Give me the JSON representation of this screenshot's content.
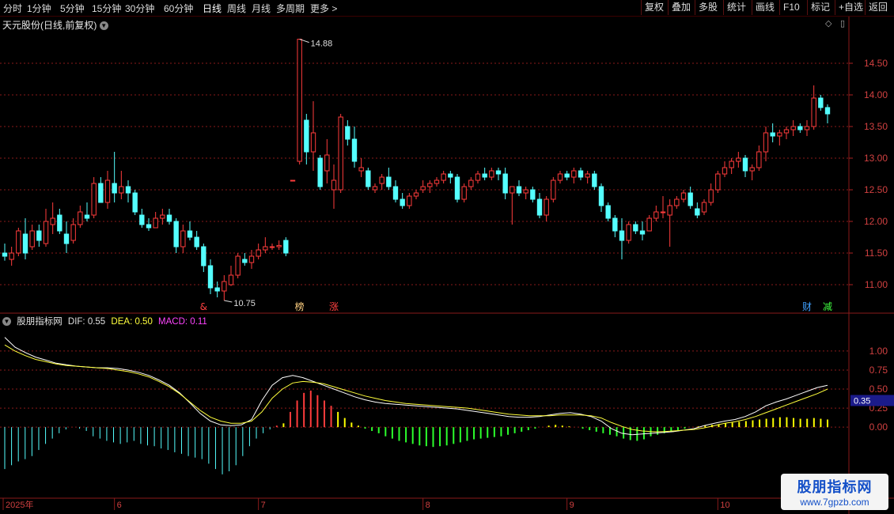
{
  "toolbar": {
    "timeframes": [
      "分时",
      "1分钟",
      "5分钟",
      "15分钟",
      "30分钟",
      "60分钟",
      "日线",
      "周线",
      "月线",
      "多周期",
      "更多 >"
    ],
    "active_timeframe": "日线",
    "buttons": [
      "复权",
      "叠加",
      "多股",
      "统计",
      "画线",
      "F10",
      "标记",
      "+自选",
      "返回"
    ]
  },
  "stock_title": "天元股份(日线,前复权)",
  "macd_header": {
    "name": "股朋指标网",
    "dif": "DIF: 0.55",
    "dea": "DEA: 0.50",
    "macd": "MACD: 0.11"
  },
  "watermark": {
    "line1": "股朋指标网",
    "line2": "www.7gpzb.com"
  },
  "colors": {
    "up": "#ff3c3c",
    "down": "#54ffff",
    "dif": "#ffffff",
    "dea": "#ffff3c",
    "macd_pos": "#ff3c3c",
    "macd_neg": "#54ffff",
    "bar_green": "#2cff2c",
    "bar_yellow": "#ffff00",
    "grid": "#8a1a1a",
    "macd_text": "#ff44ff"
  },
  "chart_data": [
    {
      "type": "candlestick",
      "title": "天元股份(日线,前复权)",
      "ylim": [
        10.6,
        15.0
      ],
      "yticks": [
        "11.00",
        "11.50",
        "12.00",
        "12.50",
        "13.00",
        "13.50",
        "14.00",
        "14.50"
      ],
      "xticks": [
        "2025年",
        "6",
        "7",
        "8",
        "9",
        "10",
        "11"
      ],
      "high_annotation": "14.88",
      "low_annotation": "10.75",
      "event_markers": [
        "&",
        "榜",
        "涨",
        "财",
        "减"
      ],
      "ohlc": [
        [
          11.5,
          11.65,
          11.38,
          11.45
        ],
        [
          11.4,
          11.6,
          11.3,
          11.5
        ],
        [
          11.5,
          11.9,
          11.45,
          11.85
        ],
        [
          11.8,
          12.05,
          11.4,
          11.5
        ],
        [
          11.6,
          11.95,
          11.55,
          11.85
        ],
        [
          11.85,
          11.95,
          11.6,
          11.7
        ],
        [
          11.65,
          12.2,
          11.6,
          12.0
        ],
        [
          11.95,
          12.3,
          11.8,
          12.05
        ],
        [
          12.1,
          12.2,
          11.8,
          11.85
        ],
        [
          11.8,
          12.0,
          11.5,
          11.65
        ],
        [
          11.7,
          12.05,
          11.65,
          11.95
        ],
        [
          11.95,
          12.25,
          11.9,
          12.15
        ],
        [
          12.1,
          12.3,
          12.0,
          12.05
        ],
        [
          12.1,
          12.7,
          12.05,
          12.6
        ],
        [
          12.6,
          12.7,
          12.3,
          12.3
        ],
        [
          12.3,
          12.8,
          12.2,
          12.65
        ],
        [
          12.6,
          13.1,
          12.3,
          12.45
        ],
        [
          12.45,
          12.8,
          12.35,
          12.55
        ],
        [
          12.55,
          12.65,
          12.3,
          12.45
        ],
        [
          12.45,
          12.5,
          12.1,
          12.15
        ],
        [
          12.1,
          12.2,
          11.9,
          11.95
        ],
        [
          11.95,
          12.05,
          11.85,
          11.9
        ],
        [
          11.9,
          12.15,
          11.9,
          12.05
        ],
        [
          12.05,
          12.2,
          11.95,
          12.1
        ],
        [
          12.1,
          12.2,
          11.95,
          12.0
        ],
        [
          12.0,
          12.05,
          11.5,
          11.6
        ],
        [
          11.6,
          11.95,
          11.5,
          11.85
        ],
        [
          11.85,
          12.0,
          11.7,
          11.75
        ],
        [
          11.75,
          11.85,
          11.55,
          11.6
        ],
        [
          11.6,
          11.65,
          11.2,
          11.3
        ],
        [
          11.3,
          11.4,
          10.85,
          10.95
        ],
        [
          10.95,
          11.05,
          10.8,
          10.9
        ],
        [
          10.9,
          11.15,
          10.75,
          11.05
        ],
        [
          11.0,
          11.3,
          10.98,
          11.15
        ],
        [
          11.15,
          11.5,
          11.1,
          11.45
        ],
        [
          11.4,
          11.5,
          11.3,
          11.35
        ],
        [
          11.35,
          11.55,
          11.25,
          11.45
        ],
        [
          11.45,
          11.65,
          11.4,
          11.55
        ],
        [
          11.55,
          11.75,
          11.5,
          11.6
        ],
        [
          11.6,
          11.65,
          11.55,
          11.6
        ],
        [
          11.6,
          11.7,
          11.55,
          11.62
        ],
        [
          11.7,
          11.75,
          11.45,
          11.5
        ],
        [
          12.65,
          12.65,
          12.65,
          12.65
        ],
        [
          12.95,
          14.88,
          12.9,
          14.88
        ],
        [
          13.6,
          13.7,
          12.9,
          13.1
        ],
        [
          13.1,
          13.9,
          12.8,
          13.4
        ],
        [
          13.0,
          13.05,
          12.5,
          12.55
        ],
        [
          12.8,
          13.3,
          12.6,
          13.05
        ],
        [
          12.5,
          12.9,
          12.2,
          12.65
        ],
        [
          12.5,
          13.7,
          12.45,
          13.65
        ],
        [
          13.5,
          13.6,
          13.2,
          13.3
        ],
        [
          13.3,
          13.5,
          12.85,
          12.95
        ],
        [
          12.8,
          13.0,
          12.7,
          12.85
        ],
        [
          12.8,
          12.85,
          12.5,
          12.55
        ],
        [
          12.5,
          12.6,
          12.45,
          12.55
        ],
        [
          12.6,
          12.75,
          12.5,
          12.7
        ],
        [
          12.7,
          12.85,
          12.5,
          12.55
        ],
        [
          12.55,
          12.65,
          12.3,
          12.35
        ],
        [
          12.35,
          12.45,
          12.2,
          12.25
        ],
        [
          12.25,
          12.45,
          12.2,
          12.4
        ],
        [
          12.4,
          12.5,
          12.35,
          12.45
        ],
        [
          12.5,
          12.65,
          12.45,
          12.55
        ],
        [
          12.55,
          12.65,
          12.45,
          12.6
        ],
        [
          12.6,
          12.7,
          12.55,
          12.65
        ],
        [
          12.65,
          12.8,
          12.6,
          12.75
        ],
        [
          12.75,
          12.8,
          12.6,
          12.7
        ],
        [
          12.7,
          12.75,
          12.3,
          12.35
        ],
        [
          12.35,
          12.6,
          12.3,
          12.55
        ],
        [
          12.55,
          12.7,
          12.5,
          12.65
        ],
        [
          12.65,
          12.8,
          12.6,
          12.75
        ],
        [
          12.75,
          12.85,
          12.65,
          12.7
        ],
        [
          12.7,
          12.85,
          12.65,
          12.8
        ],
        [
          12.8,
          12.85,
          12.65,
          12.75
        ],
        [
          12.75,
          12.85,
          12.35,
          12.45
        ],
        [
          12.45,
          12.55,
          11.95,
          12.55
        ],
        [
          12.55,
          12.65,
          12.4,
          12.45
        ],
        [
          12.45,
          12.55,
          12.35,
          12.5
        ],
        [
          12.5,
          12.55,
          12.3,
          12.35
        ],
        [
          12.35,
          12.45,
          12.05,
          12.1
        ],
        [
          12.1,
          12.4,
          12.0,
          12.35
        ],
        [
          12.35,
          12.7,
          12.3,
          12.65
        ],
        [
          12.65,
          12.8,
          12.6,
          12.75
        ],
        [
          12.75,
          12.8,
          12.65,
          12.7
        ],
        [
          12.7,
          12.85,
          12.6,
          12.8
        ],
        [
          12.8,
          12.85,
          12.65,
          12.7
        ],
        [
          12.7,
          12.8,
          12.6,
          12.75
        ],
        [
          12.75,
          12.8,
          12.5,
          12.55
        ],
        [
          12.55,
          12.6,
          12.15,
          12.25
        ],
        [
          12.25,
          12.3,
          12.0,
          12.05
        ],
        [
          12.05,
          12.1,
          11.75,
          11.85
        ],
        [
          11.85,
          12.05,
          11.4,
          11.7
        ],
        [
          11.7,
          12.0,
          11.65,
          11.95
        ],
        [
          11.95,
          12.0,
          11.8,
          11.85
        ],
        [
          11.85,
          12.0,
          11.7,
          11.8
        ],
        [
          11.85,
          12.1,
          11.85,
          12.05
        ],
        [
          12.05,
          12.25,
          12.0,
          12.15
        ],
        [
          12.15,
          12.4,
          12.05,
          12.15
        ],
        [
          12.1,
          12.35,
          11.6,
          12.25
        ],
        [
          12.25,
          12.4,
          12.2,
          12.35
        ],
        [
          12.35,
          12.5,
          12.3,
          12.45
        ],
        [
          12.45,
          12.55,
          12.2,
          12.25
        ],
        [
          12.2,
          12.3,
          12.05,
          12.1
        ],
        [
          12.15,
          12.35,
          12.1,
          12.3
        ],
        [
          12.3,
          12.6,
          12.25,
          12.5
        ],
        [
          12.5,
          12.8,
          12.45,
          12.75
        ],
        [
          12.75,
          12.95,
          12.7,
          12.85
        ],
        [
          12.85,
          13.0,
          12.75,
          12.95
        ],
        [
          12.95,
          13.1,
          12.85,
          13.0
        ],
        [
          13.0,
          13.05,
          12.7,
          12.8
        ],
        [
          12.8,
          12.9,
          12.65,
          12.85
        ],
        [
          12.85,
          13.2,
          12.8,
          13.1
        ],
        [
          13.1,
          13.5,
          12.95,
          13.4
        ],
        [
          13.4,
          13.55,
          13.25,
          13.35
        ],
        [
          13.35,
          13.45,
          13.2,
          13.4
        ],
        [
          13.4,
          13.5,
          13.3,
          13.45
        ],
        [
          13.45,
          13.6,
          13.35,
          13.5
        ],
        [
          13.5,
          13.55,
          13.4,
          13.45
        ],
        [
          13.45,
          13.6,
          13.35,
          13.5
        ],
        [
          13.5,
          14.15,
          13.45,
          13.95
        ],
        [
          13.95,
          14.0,
          13.75,
          13.8
        ],
        [
          13.8,
          13.85,
          13.55,
          13.7
        ]
      ]
    },
    {
      "type": "macd",
      "title": "股朋指标网",
      "ylim": [
        -0.85,
        1.3
      ],
      "yticks": [
        "0.00",
        "0.25",
        "0.50",
        "0.75",
        "1.00"
      ],
      "current_value_label": "0.35",
      "DIF": 0.55,
      "DEA": 0.5,
      "MACD": 0.11,
      "dif_series": [
        1.18,
        1.05,
        0.98,
        0.92,
        0.88,
        0.84,
        0.82,
        0.8,
        0.79,
        0.78,
        0.78,
        0.77,
        0.75,
        0.72,
        0.68,
        0.62,
        0.55,
        0.45,
        0.32,
        0.18,
        0.08,
        0.03,
        0.02,
        0.03,
        0.1,
        0.35,
        0.55,
        0.65,
        0.68,
        0.65,
        0.6,
        0.55,
        0.5,
        0.45,
        0.4,
        0.36,
        0.33,
        0.31,
        0.3,
        0.29,
        0.28,
        0.27,
        0.26,
        0.25,
        0.24,
        0.22,
        0.2,
        0.18,
        0.16,
        0.14,
        0.13,
        0.13,
        0.14,
        0.16,
        0.18,
        0.19,
        0.17,
        0.14,
        0.08,
        -0.02,
        -0.08,
        -0.1,
        -0.09,
        -0.08,
        -0.07,
        -0.06,
        -0.04,
        -0.02,
        0.02,
        0.05,
        0.08,
        0.1,
        0.14,
        0.2,
        0.28,
        0.33,
        0.37,
        0.42,
        0.47,
        0.52,
        0.55
      ],
      "dea_series": [
        1.08,
        1.0,
        0.94,
        0.89,
        0.86,
        0.83,
        0.81,
        0.8,
        0.79,
        0.78,
        0.77,
        0.75,
        0.73,
        0.7,
        0.66,
        0.6,
        0.53,
        0.44,
        0.33,
        0.22,
        0.13,
        0.08,
        0.05,
        0.05,
        0.08,
        0.2,
        0.38,
        0.5,
        0.58,
        0.6,
        0.59,
        0.57,
        0.53,
        0.49,
        0.45,
        0.41,
        0.38,
        0.35,
        0.33,
        0.31,
        0.3,
        0.29,
        0.28,
        0.27,
        0.26,
        0.25,
        0.23,
        0.21,
        0.19,
        0.17,
        0.16,
        0.15,
        0.15,
        0.15,
        0.16,
        0.16,
        0.16,
        0.15,
        0.12,
        0.06,
        0.01,
        -0.03,
        -0.05,
        -0.06,
        -0.06,
        -0.05,
        -0.04,
        -0.03,
        -0.01,
        0.02,
        0.05,
        0.07,
        0.1,
        0.14,
        0.19,
        0.24,
        0.29,
        0.34,
        0.39,
        0.44,
        0.5
      ],
      "histogram": [
        -0.55,
        -0.5,
        -0.45,
        -0.42,
        -0.38,
        -0.3,
        -0.22,
        -0.15,
        -0.08,
        -0.03,
        0.0,
        -0.02,
        -0.05,
        -0.12,
        -0.15,
        -0.18,
        -0.2,
        -0.22,
        -0.2,
        -0.18,
        -0.22,
        -0.24,
        -0.25,
        -0.28,
        -0.3,
        -0.33,
        -0.35,
        -0.38,
        -0.4,
        -0.42,
        -0.48,
        -0.55,
        -0.62,
        -0.58,
        -0.5,
        -0.38,
        -0.25,
        -0.15,
        -0.08,
        -0.03,
        0.02,
        0.05,
        0.2,
        0.35,
        0.45,
        0.48,
        0.42,
        0.35,
        0.28,
        0.2,
        0.12,
        0.06,
        0.02,
        -0.02,
        -0.05,
        -0.08,
        -0.12,
        -0.15,
        -0.18,
        -0.2,
        -0.22,
        -0.24,
        -0.25,
        -0.26,
        -0.25,
        -0.24,
        -0.22,
        -0.2,
        -0.18,
        -0.16,
        -0.15,
        -0.14,
        -0.13,
        -0.12,
        -0.1,
        -0.08,
        -0.06,
        -0.04,
        -0.02,
        0.0,
        0.02,
        0.03,
        0.02,
        0.01,
        0.0,
        -0.02,
        -0.04,
        -0.06,
        -0.08,
        -0.1,
        -0.12,
        -0.15,
        -0.17,
        -0.18,
        -0.16,
        -0.12,
        -0.1,
        -0.08,
        -0.06,
        -0.04,
        -0.02,
        0.0,
        0.01,
        0.02,
        0.03,
        0.04,
        0.05,
        0.06,
        0.07,
        0.08,
        0.09,
        0.1,
        0.11,
        0.12,
        0.13,
        0.13,
        0.12,
        0.11,
        0.11,
        0.12,
        0.11,
        0.1
      ]
    }
  ]
}
